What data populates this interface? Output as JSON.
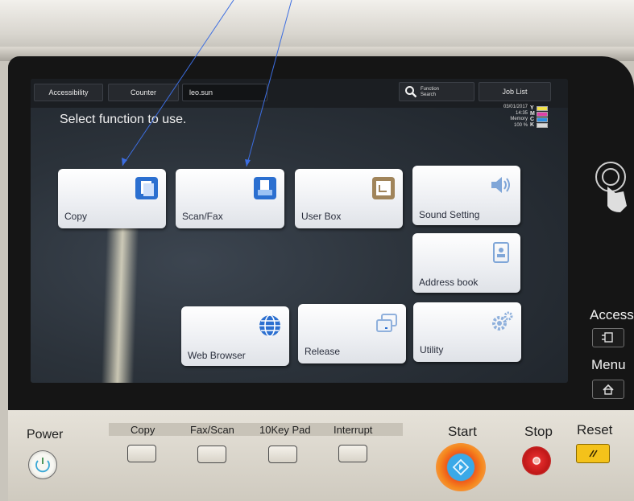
{
  "screen": {
    "top_tabs": [
      "Accessibility",
      "Counter"
    ],
    "user": "leo.sun",
    "function_search_label": "Function Search",
    "job_list_label": "Job List",
    "prompt": "Select function to use.",
    "status_date": "03/01/2017",
    "status_time": "14:35",
    "status_memory_label": "Memory",
    "status_memory_value": "100 %",
    "toner": [
      {
        "letter": "Y",
        "color": "#f2e24a"
      },
      {
        "letter": "M",
        "color": "#e040a8"
      },
      {
        "letter": "C",
        "color": "#2e8ee0"
      },
      {
        "letter": "K",
        "color": "#d8d8d8"
      }
    ]
  },
  "tiles": {
    "copy": "Copy",
    "scan_fax": "Scan/Fax",
    "user_box": "User Box",
    "sound_setting": "Sound Setting",
    "address_book": "Address book",
    "web_browser": "Web Browser",
    "release": "Release",
    "utility": "Utility"
  },
  "panel": {
    "power": "Power",
    "copy": "Copy",
    "fax_scan": "Fax/Scan",
    "tenkey": "10Key Pad",
    "interrupt": "Interrupt",
    "start": "Start",
    "stop": "Stop",
    "reset": "Reset"
  },
  "side": {
    "access": "Access",
    "menu": "Menu"
  },
  "colors": {
    "accent_blue": "#2b6fd0",
    "start_orange": "#f26a1b",
    "stop_red": "#d42020",
    "reset_yellow": "#f4c21a"
  }
}
